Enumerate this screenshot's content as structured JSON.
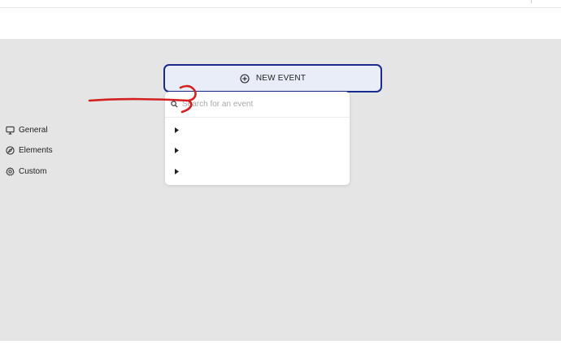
{
  "toolbar": {
    "new_event_label": "NEW EVENT"
  },
  "search": {
    "placeholder": "Search for an event",
    "value": ""
  },
  "menu": {
    "items": [
      {
        "label": "General",
        "icon": "monitor-icon"
      },
      {
        "label": "Elements",
        "icon": "compass-icon"
      },
      {
        "label": "Custom",
        "icon": "gear-icon"
      }
    ]
  },
  "colors": {
    "button_border": "#1a2b8c",
    "button_fill": "#e8edf8",
    "canvas_bg": "#e5e5e5",
    "annotation": "#d42020"
  }
}
